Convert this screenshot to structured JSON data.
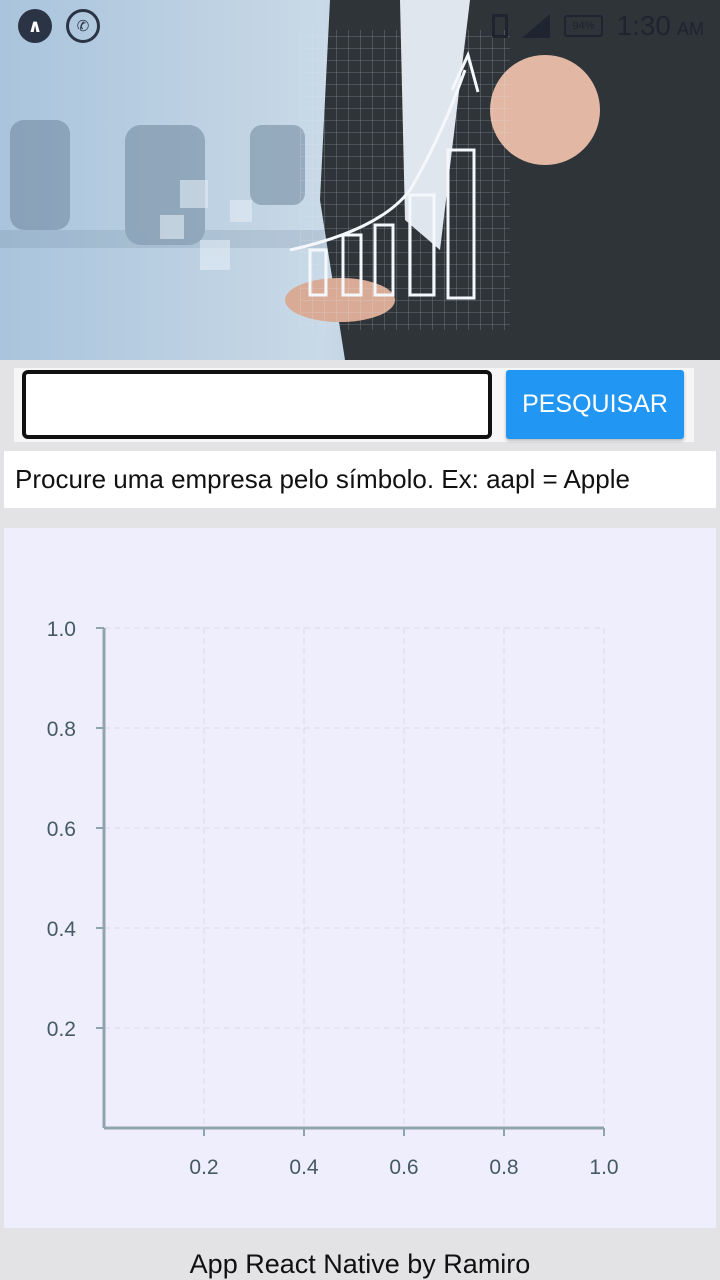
{
  "status_bar": {
    "icons": [
      "app-drawer-icon",
      "whatsapp-icon",
      "sim-icon",
      "signal-icon",
      "battery-icon"
    ],
    "battery": "94%",
    "time": "1:30",
    "ampm": "AM"
  },
  "hero": {
    "description_icon": "business-chart-photo"
  },
  "search": {
    "value": "",
    "placeholder": "",
    "button_label": "PESQUISAR"
  },
  "hint": "Procure uma empresa pelo símbolo. Ex: aapl = Apple",
  "chart_data": {
    "type": "line",
    "title": "",
    "xlabel": "",
    "ylabel": "",
    "xlim": [
      0,
      1.0
    ],
    "ylim": [
      0,
      1.0
    ],
    "x_ticks": [
      "0.2",
      "0.4",
      "0.6",
      "0.8",
      "1.0"
    ],
    "y_ticks": [
      "1.0",
      "0.8",
      "0.6",
      "0.4",
      "0.2"
    ],
    "x_values": [
      0.2,
      0.4,
      0.6,
      0.8,
      1.0
    ],
    "y_values": [
      1.0,
      0.8,
      0.6,
      0.4,
      0.2
    ],
    "series": [],
    "grid": true
  },
  "footer": "App React Native by Ramiro",
  "colors": {
    "accent": "#2196f3",
    "chart_bg": "#efeefd",
    "axis": "#90a4ae",
    "tick_text": "#455a64"
  }
}
